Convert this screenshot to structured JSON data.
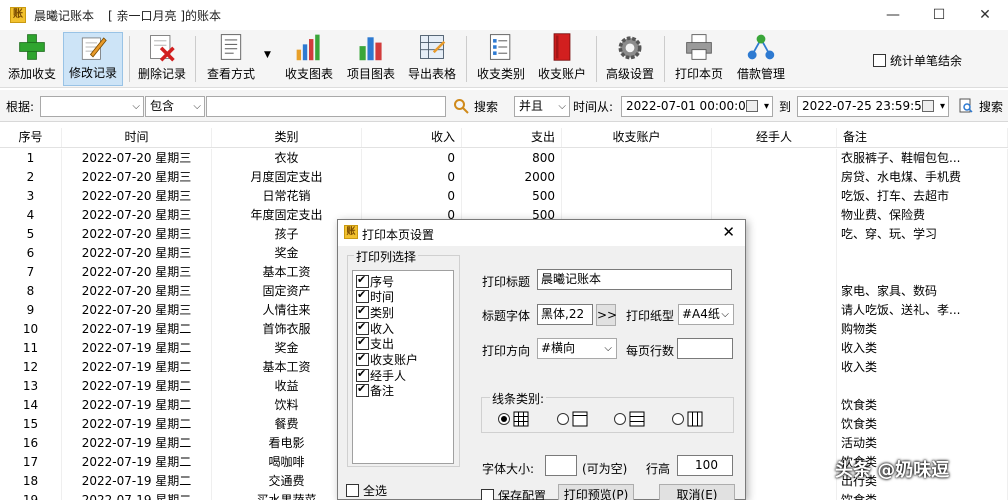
{
  "window": {
    "app_logo": "账",
    "title": "晨曦记账本",
    "subtitle": "[ 亲一口月亮 ]的账本",
    "minimize": "—",
    "maximize": "☐",
    "close": "✕"
  },
  "toolbar": {
    "add": "添加收支",
    "edit": "修改记录",
    "delete": "删除记录",
    "view_mode": "查看方式",
    "chart": "收支图表",
    "item_chart": "项目图表",
    "export": "导出表格",
    "category": "收支类别",
    "account": "收支账户",
    "advanced": "高级设置",
    "print": "打印本页",
    "loan": "借款管理",
    "stat_single": "统计单笔结余"
  },
  "filter": {
    "basis_label": "根据:",
    "basis_value": "",
    "match_value": "包含",
    "search": "搜索",
    "logic_value": "并且",
    "time_from_label": "时间从:",
    "time_from": "2022-07-01 00:00:00",
    "to_label": "到",
    "time_to": "2022-07-25 23:59:59",
    "search2": "搜索"
  },
  "table": {
    "headers": [
      "序号",
      "时间",
      "类别",
      "收入",
      "支出",
      "收支账户",
      "经手人",
      "备注"
    ],
    "rows": [
      [
        "1",
        "2022-07-20  星期三",
        "衣妆",
        "0",
        "800",
        "",
        "",
        "衣服裤子、鞋帽包包..."
      ],
      [
        "2",
        "2022-07-20  星期三",
        "月度固定支出",
        "0",
        "2000",
        "",
        "",
        "房贷、水电煤、手机费"
      ],
      [
        "3",
        "2022-07-20  星期三",
        "日常花销",
        "0",
        "500",
        "",
        "",
        "吃饭、打车、去超市"
      ],
      [
        "4",
        "2022-07-20  星期三",
        "年度固定支出",
        "0",
        "500",
        "",
        "",
        "物业费、保险费"
      ],
      [
        "5",
        "2022-07-20  星期三",
        "孩子",
        "",
        "",
        "",
        "",
        "吃、穿、玩、学习"
      ],
      [
        "6",
        "2022-07-20  星期三",
        "奖金",
        "",
        "",
        "",
        "",
        ""
      ],
      [
        "7",
        "2022-07-20  星期三",
        "基本工资",
        "",
        "",
        "",
        "",
        ""
      ],
      [
        "8",
        "2022-07-20  星期三",
        "固定资产",
        "",
        "",
        "",
        "",
        "家电、家具、数码"
      ],
      [
        "9",
        "2022-07-20  星期三",
        "人情往来",
        "",
        "",
        "",
        "",
        "请人吃饭、送礼、孝..."
      ],
      [
        "10",
        "2022-07-19  星期二",
        "首饰衣服",
        "",
        "",
        "",
        "",
        "购物类"
      ],
      [
        "11",
        "2022-07-19  星期二",
        "奖金",
        "",
        "",
        "",
        "",
        "收入类"
      ],
      [
        "12",
        "2022-07-19  星期二",
        "基本工资",
        "",
        "",
        "",
        "",
        "收入类"
      ],
      [
        "13",
        "2022-07-19  星期二",
        "收益",
        "",
        "",
        "",
        "",
        ""
      ],
      [
        "14",
        "2022-07-19  星期二",
        "饮料",
        "",
        "",
        "",
        "",
        "饮食类"
      ],
      [
        "15",
        "2022-07-19  星期二",
        "餐费",
        "",
        "",
        "",
        "",
        "饮食类"
      ],
      [
        "16",
        "2022-07-19  星期二",
        "看电影",
        "",
        "",
        "",
        "",
        "活动类"
      ],
      [
        "17",
        "2022-07-19  星期二",
        "喝咖啡",
        "",
        "",
        "",
        "",
        "饮食类"
      ],
      [
        "18",
        "2022-07-19  星期二",
        "交通费",
        "",
        "",
        "",
        "",
        "出行类"
      ],
      [
        "19",
        "2022-07-19  星期二",
        "买水果蔬菜",
        "",
        "",
        "",
        "",
        "饮食类"
      ]
    ]
  },
  "dialog": {
    "logo": "账",
    "title": "打印本页设置",
    "close": "✕",
    "columns_legend": "打印列选择",
    "columns": [
      "序号",
      "时间",
      "类别",
      "收入",
      "支出",
      "收支账户",
      "经手人",
      "备注"
    ],
    "select_all": "全选",
    "print_title_label": "打印标题",
    "print_title_value": "晨曦记账本",
    "title_font_label": "标题字体",
    "title_font_value": "黑体,22",
    "font_btn": ">>",
    "paper_label": "打印纸型",
    "paper_value": "#A4纸",
    "direction_label": "打印方向",
    "direction_value": "#横向",
    "rows_per_page_label": "每页行数",
    "rows_per_page_value": "",
    "line_type_legend": "线条类别:",
    "font_size_label": "字体大小:",
    "font_size_value": "",
    "font_size_hint": "(可为空)",
    "row_height_label": "行高",
    "row_height_value": "100",
    "save_config": "保存配置",
    "preview": "打印预览(P)",
    "cancel": "取消(E)"
  },
  "watermark": "头条 @奶味逗"
}
